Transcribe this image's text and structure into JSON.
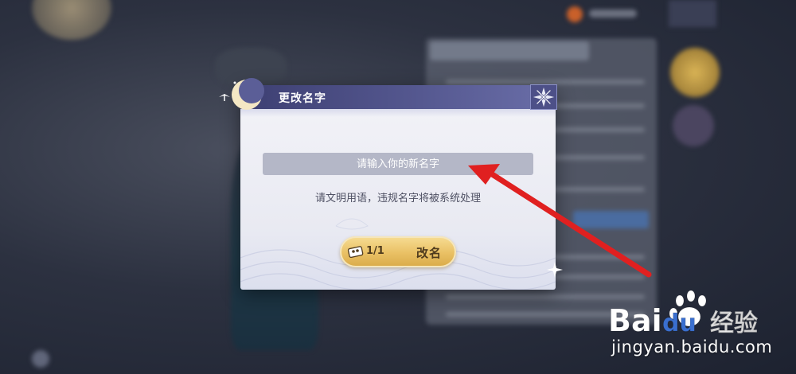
{
  "dialog": {
    "title": "更改名字",
    "input_placeholder": "请输入你的新名字",
    "hint": "请文明用语，违规名字将被系统处理",
    "rename_button": {
      "count": "1/1",
      "label": "改名"
    }
  },
  "watermark": {
    "brand": "Baidu经验",
    "url": "jingyan.baidu.com"
  },
  "icons": {
    "moon": "crescent-moon-icon",
    "close": "close-icon",
    "ticket": "rename-ticket-icon",
    "sparkle": "sparkle-icon"
  },
  "colors": {
    "header": "#3d3f72",
    "button_gold": "#e9c064",
    "arrow": "#e02020"
  }
}
